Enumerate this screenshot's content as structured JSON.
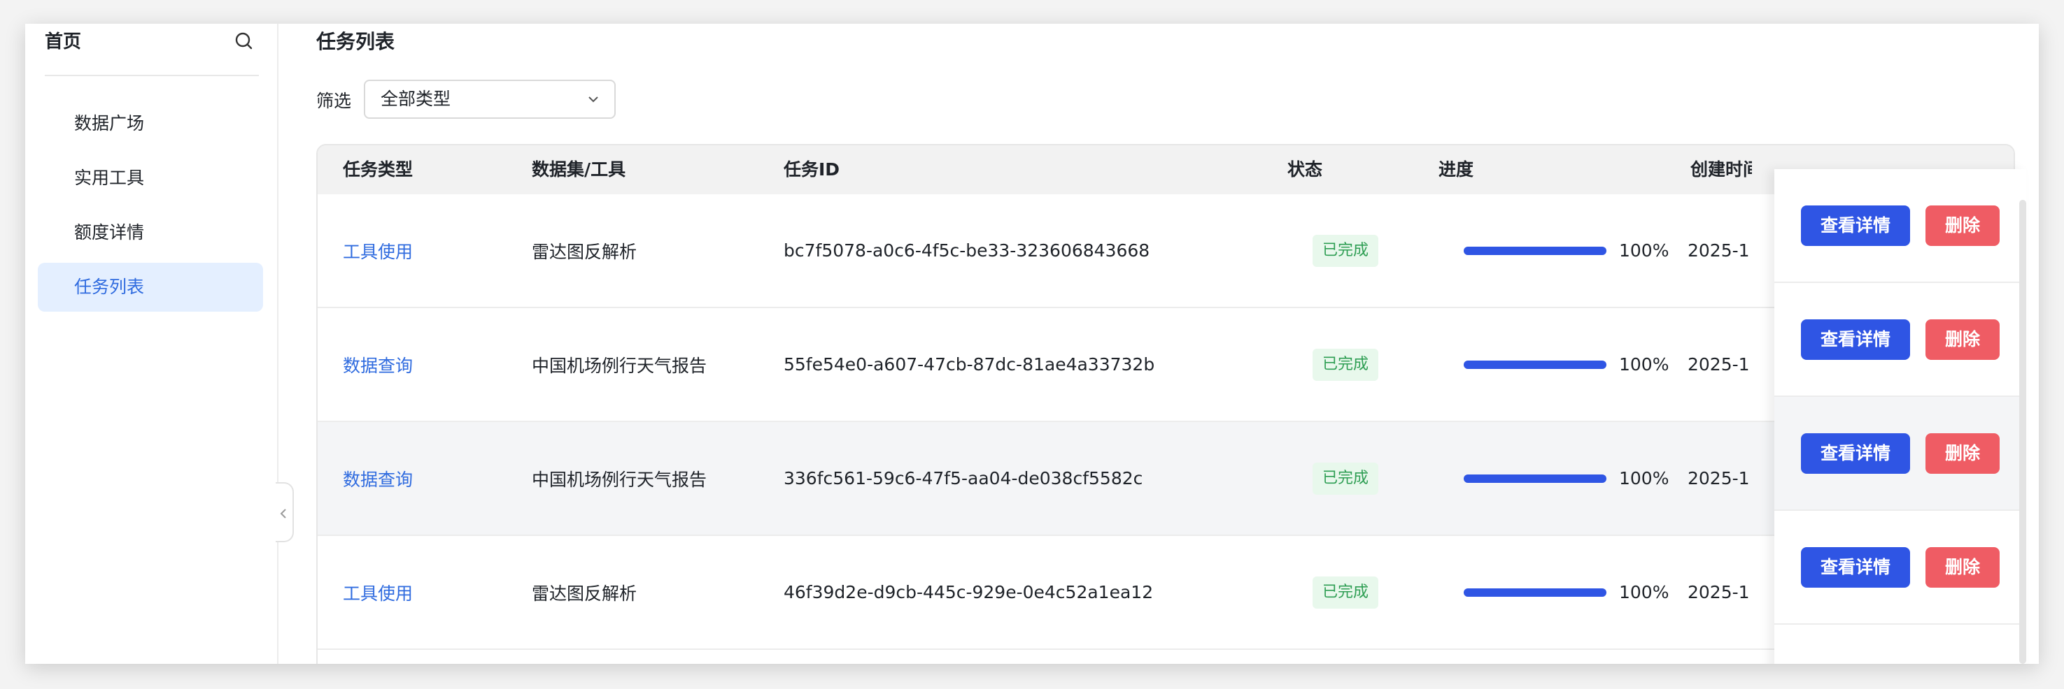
{
  "sidebar": {
    "title": "首页",
    "search_icon": "search-icon",
    "items": [
      {
        "label": "数据广场",
        "active": false
      },
      {
        "label": "实用工具",
        "active": false
      },
      {
        "label": "额度详情",
        "active": false
      },
      {
        "label": "任务列表",
        "active": true
      }
    ]
  },
  "main": {
    "title": "任务列表",
    "filter": {
      "label": "筛选",
      "selected": "全部类型"
    }
  },
  "table": {
    "columns": [
      "任务类型",
      "数据集/工具",
      "任务ID",
      "状态",
      "进度",
      "创建时间"
    ],
    "rows": [
      {
        "type": "工具使用",
        "dataset": "雷达图反解析",
        "id": "bc7f5078-a0c6-4f5c-be33-323606843668",
        "status": "已完成",
        "progress": 100,
        "progress_text": "100%",
        "created": "2025-1",
        "highlighted": false
      },
      {
        "type": "数据查询",
        "dataset": "中国机场例行天气报告",
        "id": "55fe54e0-a607-47cb-87dc-81ae4a33732b",
        "status": "已完成",
        "progress": 100,
        "progress_text": "100%",
        "created": "2025-1",
        "highlighted": false
      },
      {
        "type": "数据查询",
        "dataset": "中国机场例行天气报告",
        "id": "336fc561-59c6-47f5-aa04-de038cf5582c",
        "status": "已完成",
        "progress": 100,
        "progress_text": "100%",
        "created": "2025-1",
        "highlighted": true
      },
      {
        "type": "工具使用",
        "dataset": "雷达图反解析",
        "id": "46f39d2e-d9cb-445c-929e-0e4c52a1ea12",
        "status": "已完成",
        "progress": 100,
        "progress_text": "100%",
        "created": "2025-1",
        "highlighted": false
      }
    ],
    "actions": {
      "view": "查看详情",
      "delete": "删除"
    }
  },
  "colors": {
    "accent": "#2f55e4",
    "link": "#2f6bdf",
    "danger": "#ef5c64",
    "success_bg": "#e8f8ec",
    "success_text": "#2e9e53",
    "active_nav_bg": "#e4efff"
  }
}
